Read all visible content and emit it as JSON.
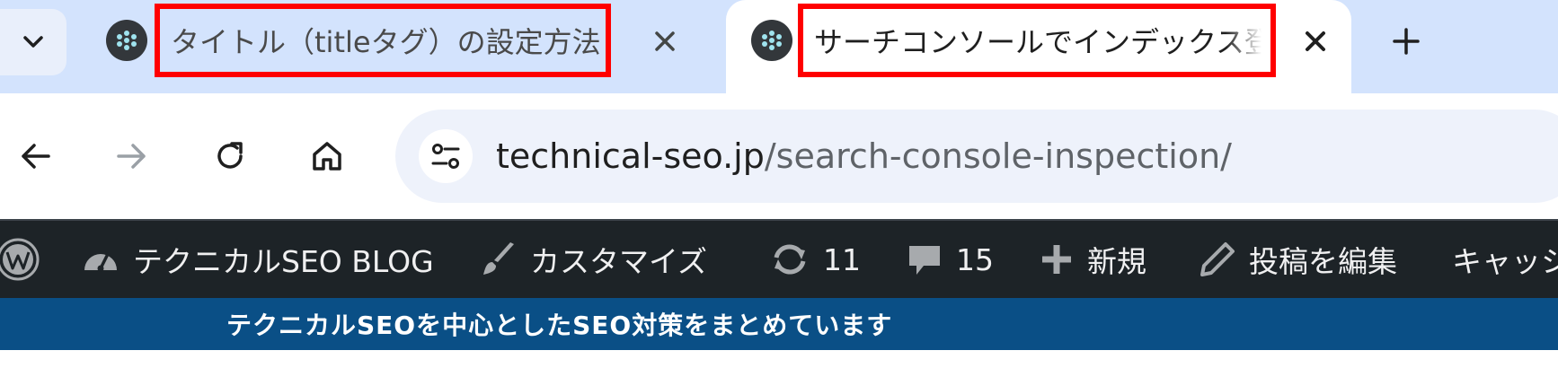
{
  "browser": {
    "tabs": [
      {
        "title": "タイトル（titleタグ）の設定方法",
        "active": false,
        "favicon": "site-favicon"
      },
      {
        "title": "サーチコンソールでインデックス登録で",
        "active": true,
        "favicon": "site-favicon"
      }
    ],
    "address_bar": {
      "host": "technical-seo.jp",
      "path": "/search-console-inspection/"
    }
  },
  "admin_bar": {
    "site_name": "テクニカルSEO BLOG",
    "customize": "カスタマイズ",
    "updates_count": "11",
    "comments_count": "15",
    "new_label": "新規",
    "edit_post": "投稿を編集",
    "cache_label": "キャッシ"
  },
  "site": {
    "tagline": "テクニカルSEOを中心としたSEO対策をまとめています"
  },
  "colors": {
    "highlight_border": "#ff0000",
    "tab_strip": "#d3e3fd",
    "admin_bar": "#1d2327",
    "tagline_bar": "#0a4f86"
  }
}
